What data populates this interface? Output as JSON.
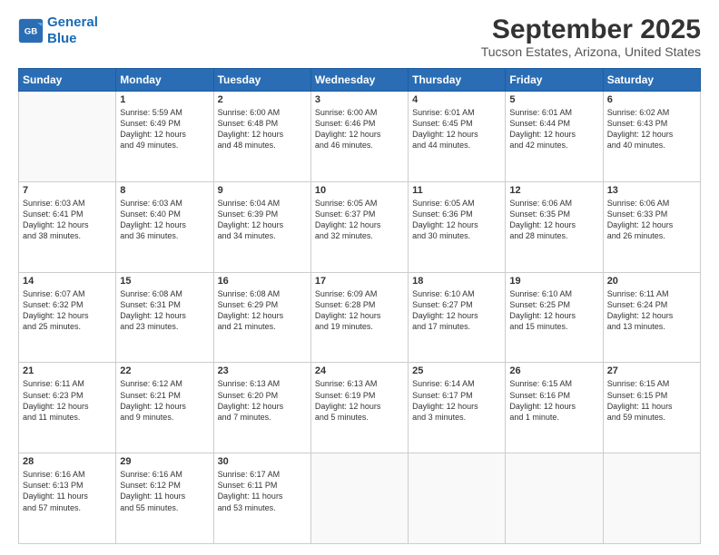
{
  "logo": {
    "line1": "General",
    "line2": "Blue"
  },
  "header": {
    "month": "September 2025",
    "location": "Tucson Estates, Arizona, United States"
  },
  "weekdays": [
    "Sunday",
    "Monday",
    "Tuesday",
    "Wednesday",
    "Thursday",
    "Friday",
    "Saturday"
  ],
  "weeks": [
    [
      {
        "day": "",
        "info": ""
      },
      {
        "day": "1",
        "info": "Sunrise: 5:59 AM\nSunset: 6:49 PM\nDaylight: 12 hours\nand 49 minutes."
      },
      {
        "day": "2",
        "info": "Sunrise: 6:00 AM\nSunset: 6:48 PM\nDaylight: 12 hours\nand 48 minutes."
      },
      {
        "day": "3",
        "info": "Sunrise: 6:00 AM\nSunset: 6:46 PM\nDaylight: 12 hours\nand 46 minutes."
      },
      {
        "day": "4",
        "info": "Sunrise: 6:01 AM\nSunset: 6:45 PM\nDaylight: 12 hours\nand 44 minutes."
      },
      {
        "day": "5",
        "info": "Sunrise: 6:01 AM\nSunset: 6:44 PM\nDaylight: 12 hours\nand 42 minutes."
      },
      {
        "day": "6",
        "info": "Sunrise: 6:02 AM\nSunset: 6:43 PM\nDaylight: 12 hours\nand 40 minutes."
      }
    ],
    [
      {
        "day": "7",
        "info": "Sunrise: 6:03 AM\nSunset: 6:41 PM\nDaylight: 12 hours\nand 38 minutes."
      },
      {
        "day": "8",
        "info": "Sunrise: 6:03 AM\nSunset: 6:40 PM\nDaylight: 12 hours\nand 36 minutes."
      },
      {
        "day": "9",
        "info": "Sunrise: 6:04 AM\nSunset: 6:39 PM\nDaylight: 12 hours\nand 34 minutes."
      },
      {
        "day": "10",
        "info": "Sunrise: 6:05 AM\nSunset: 6:37 PM\nDaylight: 12 hours\nand 32 minutes."
      },
      {
        "day": "11",
        "info": "Sunrise: 6:05 AM\nSunset: 6:36 PM\nDaylight: 12 hours\nand 30 minutes."
      },
      {
        "day": "12",
        "info": "Sunrise: 6:06 AM\nSunset: 6:35 PM\nDaylight: 12 hours\nand 28 minutes."
      },
      {
        "day": "13",
        "info": "Sunrise: 6:06 AM\nSunset: 6:33 PM\nDaylight: 12 hours\nand 26 minutes."
      }
    ],
    [
      {
        "day": "14",
        "info": "Sunrise: 6:07 AM\nSunset: 6:32 PM\nDaylight: 12 hours\nand 25 minutes."
      },
      {
        "day": "15",
        "info": "Sunrise: 6:08 AM\nSunset: 6:31 PM\nDaylight: 12 hours\nand 23 minutes."
      },
      {
        "day": "16",
        "info": "Sunrise: 6:08 AM\nSunset: 6:29 PM\nDaylight: 12 hours\nand 21 minutes."
      },
      {
        "day": "17",
        "info": "Sunrise: 6:09 AM\nSunset: 6:28 PM\nDaylight: 12 hours\nand 19 minutes."
      },
      {
        "day": "18",
        "info": "Sunrise: 6:10 AM\nSunset: 6:27 PM\nDaylight: 12 hours\nand 17 minutes."
      },
      {
        "day": "19",
        "info": "Sunrise: 6:10 AM\nSunset: 6:25 PM\nDaylight: 12 hours\nand 15 minutes."
      },
      {
        "day": "20",
        "info": "Sunrise: 6:11 AM\nSunset: 6:24 PM\nDaylight: 12 hours\nand 13 minutes."
      }
    ],
    [
      {
        "day": "21",
        "info": "Sunrise: 6:11 AM\nSunset: 6:23 PM\nDaylight: 12 hours\nand 11 minutes."
      },
      {
        "day": "22",
        "info": "Sunrise: 6:12 AM\nSunset: 6:21 PM\nDaylight: 12 hours\nand 9 minutes."
      },
      {
        "day": "23",
        "info": "Sunrise: 6:13 AM\nSunset: 6:20 PM\nDaylight: 12 hours\nand 7 minutes."
      },
      {
        "day": "24",
        "info": "Sunrise: 6:13 AM\nSunset: 6:19 PM\nDaylight: 12 hours\nand 5 minutes."
      },
      {
        "day": "25",
        "info": "Sunrise: 6:14 AM\nSunset: 6:17 PM\nDaylight: 12 hours\nand 3 minutes."
      },
      {
        "day": "26",
        "info": "Sunrise: 6:15 AM\nSunset: 6:16 PM\nDaylight: 12 hours\nand 1 minute."
      },
      {
        "day": "27",
        "info": "Sunrise: 6:15 AM\nSunset: 6:15 PM\nDaylight: 11 hours\nand 59 minutes."
      }
    ],
    [
      {
        "day": "28",
        "info": "Sunrise: 6:16 AM\nSunset: 6:13 PM\nDaylight: 11 hours\nand 57 minutes."
      },
      {
        "day": "29",
        "info": "Sunrise: 6:16 AM\nSunset: 6:12 PM\nDaylight: 11 hours\nand 55 minutes."
      },
      {
        "day": "30",
        "info": "Sunrise: 6:17 AM\nSunset: 6:11 PM\nDaylight: 11 hours\nand 53 minutes."
      },
      {
        "day": "",
        "info": ""
      },
      {
        "day": "",
        "info": ""
      },
      {
        "day": "",
        "info": ""
      },
      {
        "day": "",
        "info": ""
      }
    ]
  ]
}
